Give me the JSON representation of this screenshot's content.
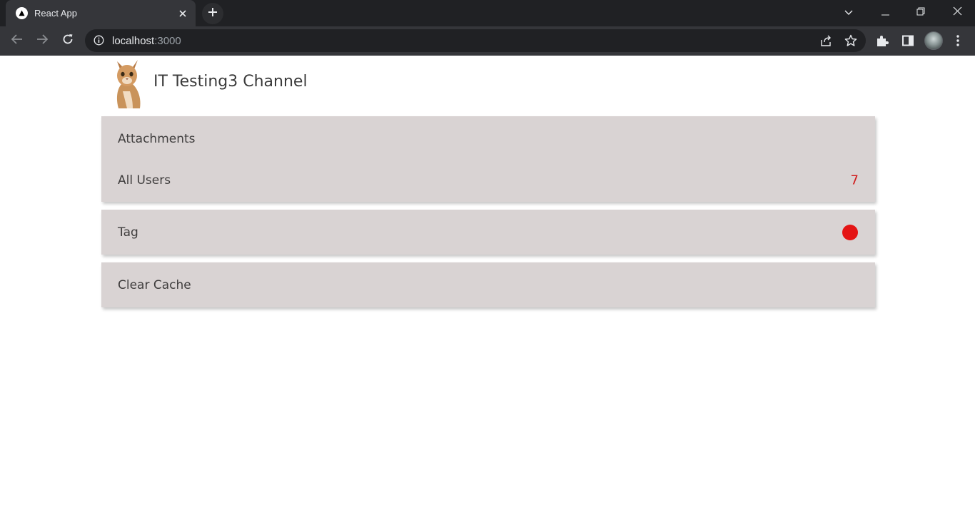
{
  "browser": {
    "tab_title": "React App",
    "url_host": "localhost",
    "url_port": ":3000",
    "icons": [
      "react-favicon-icon",
      "close-icon",
      "plus-icon",
      "chevron-down-icon",
      "minimize-icon",
      "restore-icon",
      "window-close-icon",
      "back-icon",
      "forward-icon",
      "reload-icon",
      "info-icon",
      "share-icon",
      "star-icon",
      "puzzle-icon",
      "sidebar-icon",
      "avatar",
      "menu-kebab-icon"
    ]
  },
  "header": {
    "title": "IT Testing3 Channel",
    "logo": "cat-logo"
  },
  "menu": {
    "card1": {
      "attachments_label": "Attachments",
      "all_users_label": "All Users",
      "all_users_count": "7"
    },
    "card2": {
      "tag_label": "Tag"
    },
    "card3": {
      "clear_cache_label": "Clear Cache"
    }
  },
  "colors": {
    "card_bg": "#d9d3d3",
    "count_color": "#d11919",
    "indicator": "#e41414",
    "chrome_dark": "#202124",
    "chrome_toolbar": "#35363a"
  }
}
